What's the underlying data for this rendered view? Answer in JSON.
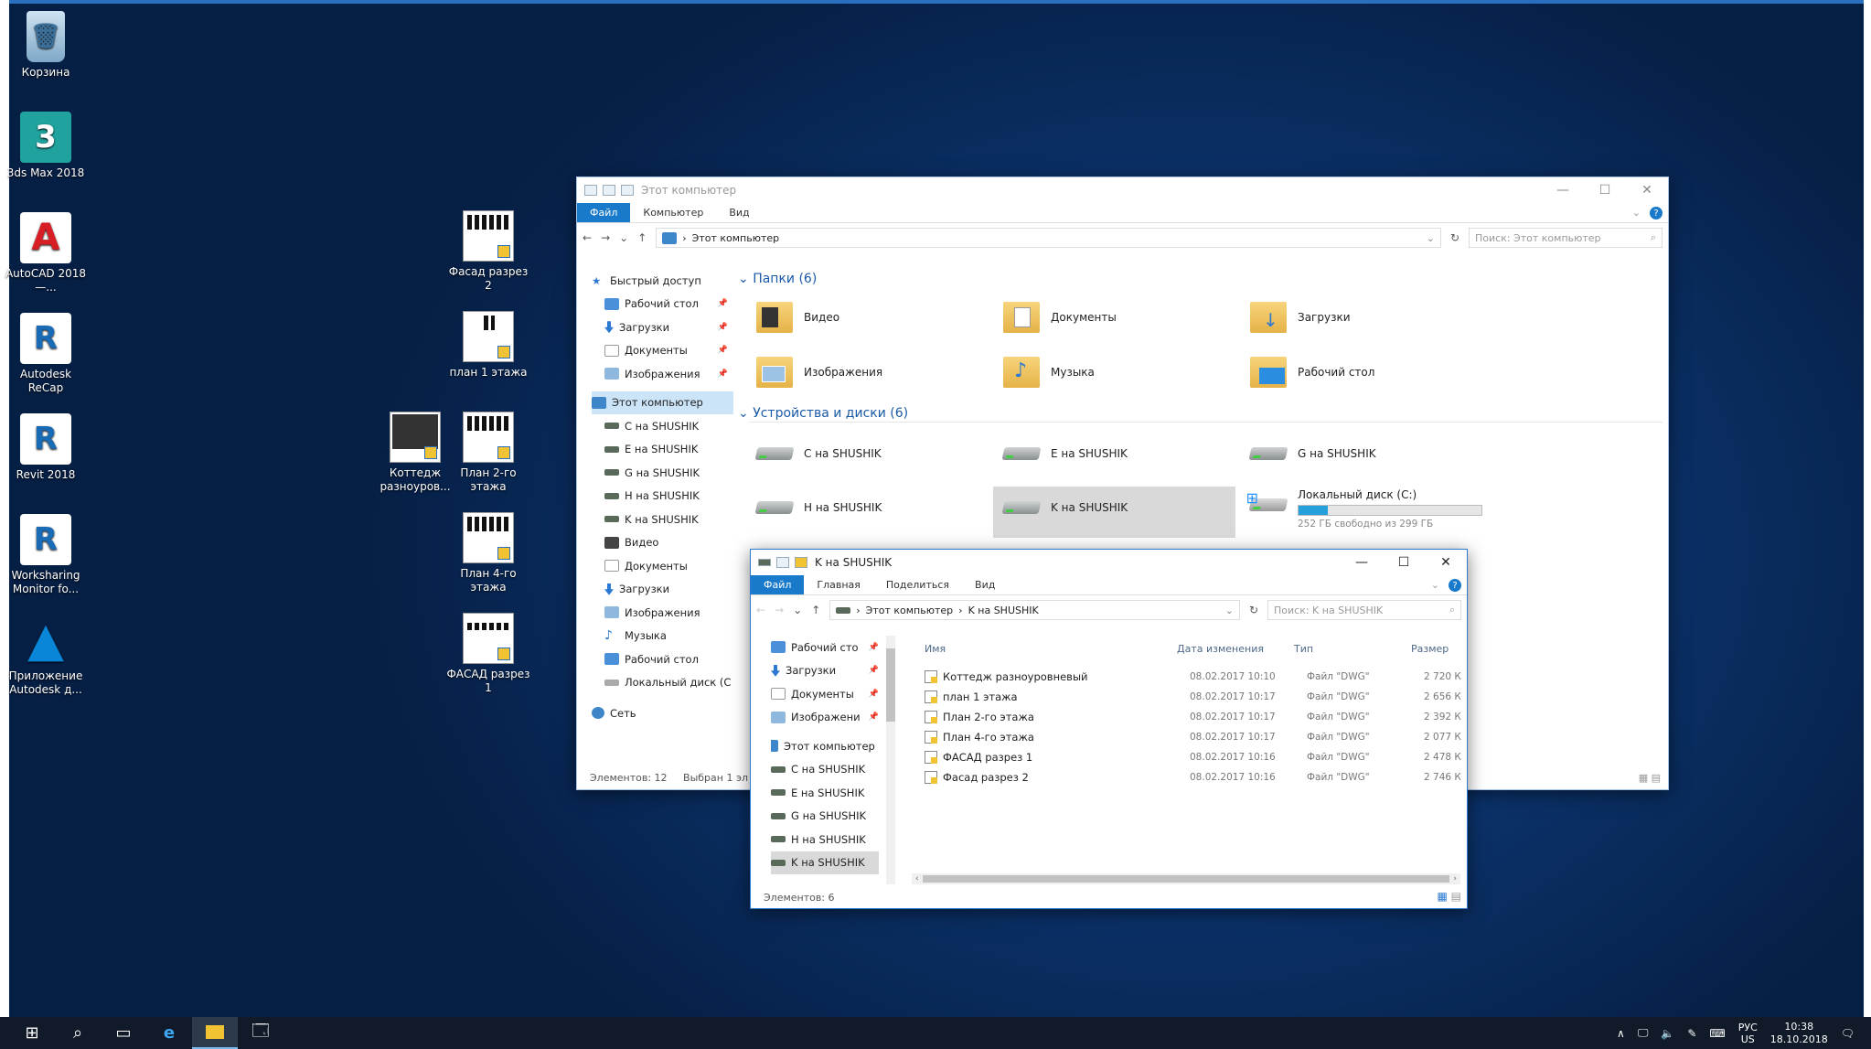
{
  "desktop": {
    "icons": [
      {
        "label": "Корзина",
        "kind": "recycle",
        "glyph": "🗑"
      },
      {
        "label": "3ds Max 2018",
        "kind": "max",
        "glyph": "3"
      },
      {
        "label": "AutoCAD 2018 —...",
        "kind": "acad",
        "glyph": "A"
      },
      {
        "label": "Autodesk ReCap",
        "kind": "revit",
        "glyph": "R"
      },
      {
        "label": "Revit 2018",
        "kind": "revit",
        "glyph": "R"
      },
      {
        "label": "Worksharing Monitor fo...",
        "kind": "revit",
        "glyph": "R"
      },
      {
        "label": "Приложение Autodesk д...",
        "kind": "adapp",
        "glyph": "▲"
      },
      {
        "label": "Фасад разрез 2",
        "kind": "dwg"
      },
      {
        "label": "план 1 этажа",
        "kind": "dwg"
      },
      {
        "label": "Коттедж разноуров...",
        "kind": "dwg-dark"
      },
      {
        "label": "План 2-го этажа",
        "kind": "dwg"
      },
      {
        "label": "План 4-го этажа",
        "kind": "dwg"
      },
      {
        "label": "ФАСАД разрез 1",
        "kind": "dwg"
      }
    ]
  },
  "window1": {
    "title": "Этот компьютер",
    "tabs": {
      "file": "Файл",
      "computer": "Компьютер",
      "view": "Вид"
    },
    "breadcrumb": "Этот компьютер",
    "search_placeholder": "Поиск: Этот компьютер",
    "nav": {
      "quick": "Быстрый доступ",
      "desktop": "Рабочий стол",
      "downloads": "Загрузки",
      "documents": "Документы",
      "images": "Изображения",
      "thispc": "Этот компьютер",
      "c": "C на SHUSHIK",
      "e": "E на SHUSHIK",
      "g": "G на SHUSHIK",
      "h": "H на SHUSHIK",
      "k": "K на SHUSHIK",
      "video": "Видео",
      "docs2": "Документы",
      "dl2": "Загрузки",
      "img2": "Изображения",
      "music": "Музыка",
      "desk2": "Рабочий стол",
      "local": "Локальный диск (C",
      "network": "Сеть"
    },
    "folders_group": "Папки (6)",
    "folders": {
      "video": "Видео",
      "documents": "Документы",
      "downloads": "Загрузки",
      "images": "Изображения",
      "music": "Музыка",
      "desktop": "Рабочий стол"
    },
    "drives_group": "Устройства и диски (6)",
    "drives": {
      "c": "C на SHUSHIK",
      "e": "E на SHUSHIK",
      "g": "G на SHUSHIK",
      "h": "H на SHUSHIK",
      "k": "K на SHUSHIK"
    },
    "local": {
      "name": "Локальный диск (C:)",
      "free": "252 ГБ свободно из 299 ГБ",
      "used_fraction": 0.16
    },
    "status_count": "Элементов: 12",
    "status_sel": "Выбран 1 эл"
  },
  "window2": {
    "title": "K на SHUSHIK",
    "tabs": {
      "file": "Файл",
      "home": "Главная",
      "share": "Поделиться",
      "view": "Вид"
    },
    "crumb1": "Этот компьютер",
    "crumb2": "K на SHUSHIK",
    "search_placeholder": "Поиск: K на SHUSHIK",
    "nav": {
      "desktop": "Рабочий сто",
      "downloads": "Загрузки",
      "documents": "Документы",
      "images": "Изображени",
      "thispc": "Этот компьютер",
      "c": "C на SHUSHIK",
      "e": "E на SHUSHIK",
      "g": "G на SHUSHIK",
      "h": "H на SHUSHIK",
      "k": "K на SHUSHIK"
    },
    "columns": {
      "name": "Имя",
      "date": "Дата изменения",
      "type": "Тип",
      "size": "Размер"
    },
    "files": [
      {
        "name": "Коттедж разноуровневый",
        "date": "08.02.2017 10:10",
        "type": "Файл \"DWG\"",
        "size": "2 720 К"
      },
      {
        "name": "план 1 этажа",
        "date": "08.02.2017 10:17",
        "type": "Файл \"DWG\"",
        "size": "2 656 К"
      },
      {
        "name": "План 2-го этажа",
        "date": "08.02.2017 10:17",
        "type": "Файл \"DWG\"",
        "size": "2 392 К"
      },
      {
        "name": "План 4-го этажа",
        "date": "08.02.2017 10:17",
        "type": "Файл \"DWG\"",
        "size": "2 077 К"
      },
      {
        "name": "ФАСАД разрез 1",
        "date": "08.02.2017 10:16",
        "type": "Файл \"DWG\"",
        "size": "2 478 К"
      },
      {
        "name": "Фасад разрез 2",
        "date": "08.02.2017 10:16",
        "type": "Файл \"DWG\"",
        "size": "2 746 К"
      }
    ],
    "status_count": "Элементов: 6"
  },
  "taskbar": {
    "lang": "РУС",
    "layout": "US",
    "time": "10:38",
    "date": "18.10.2018"
  }
}
